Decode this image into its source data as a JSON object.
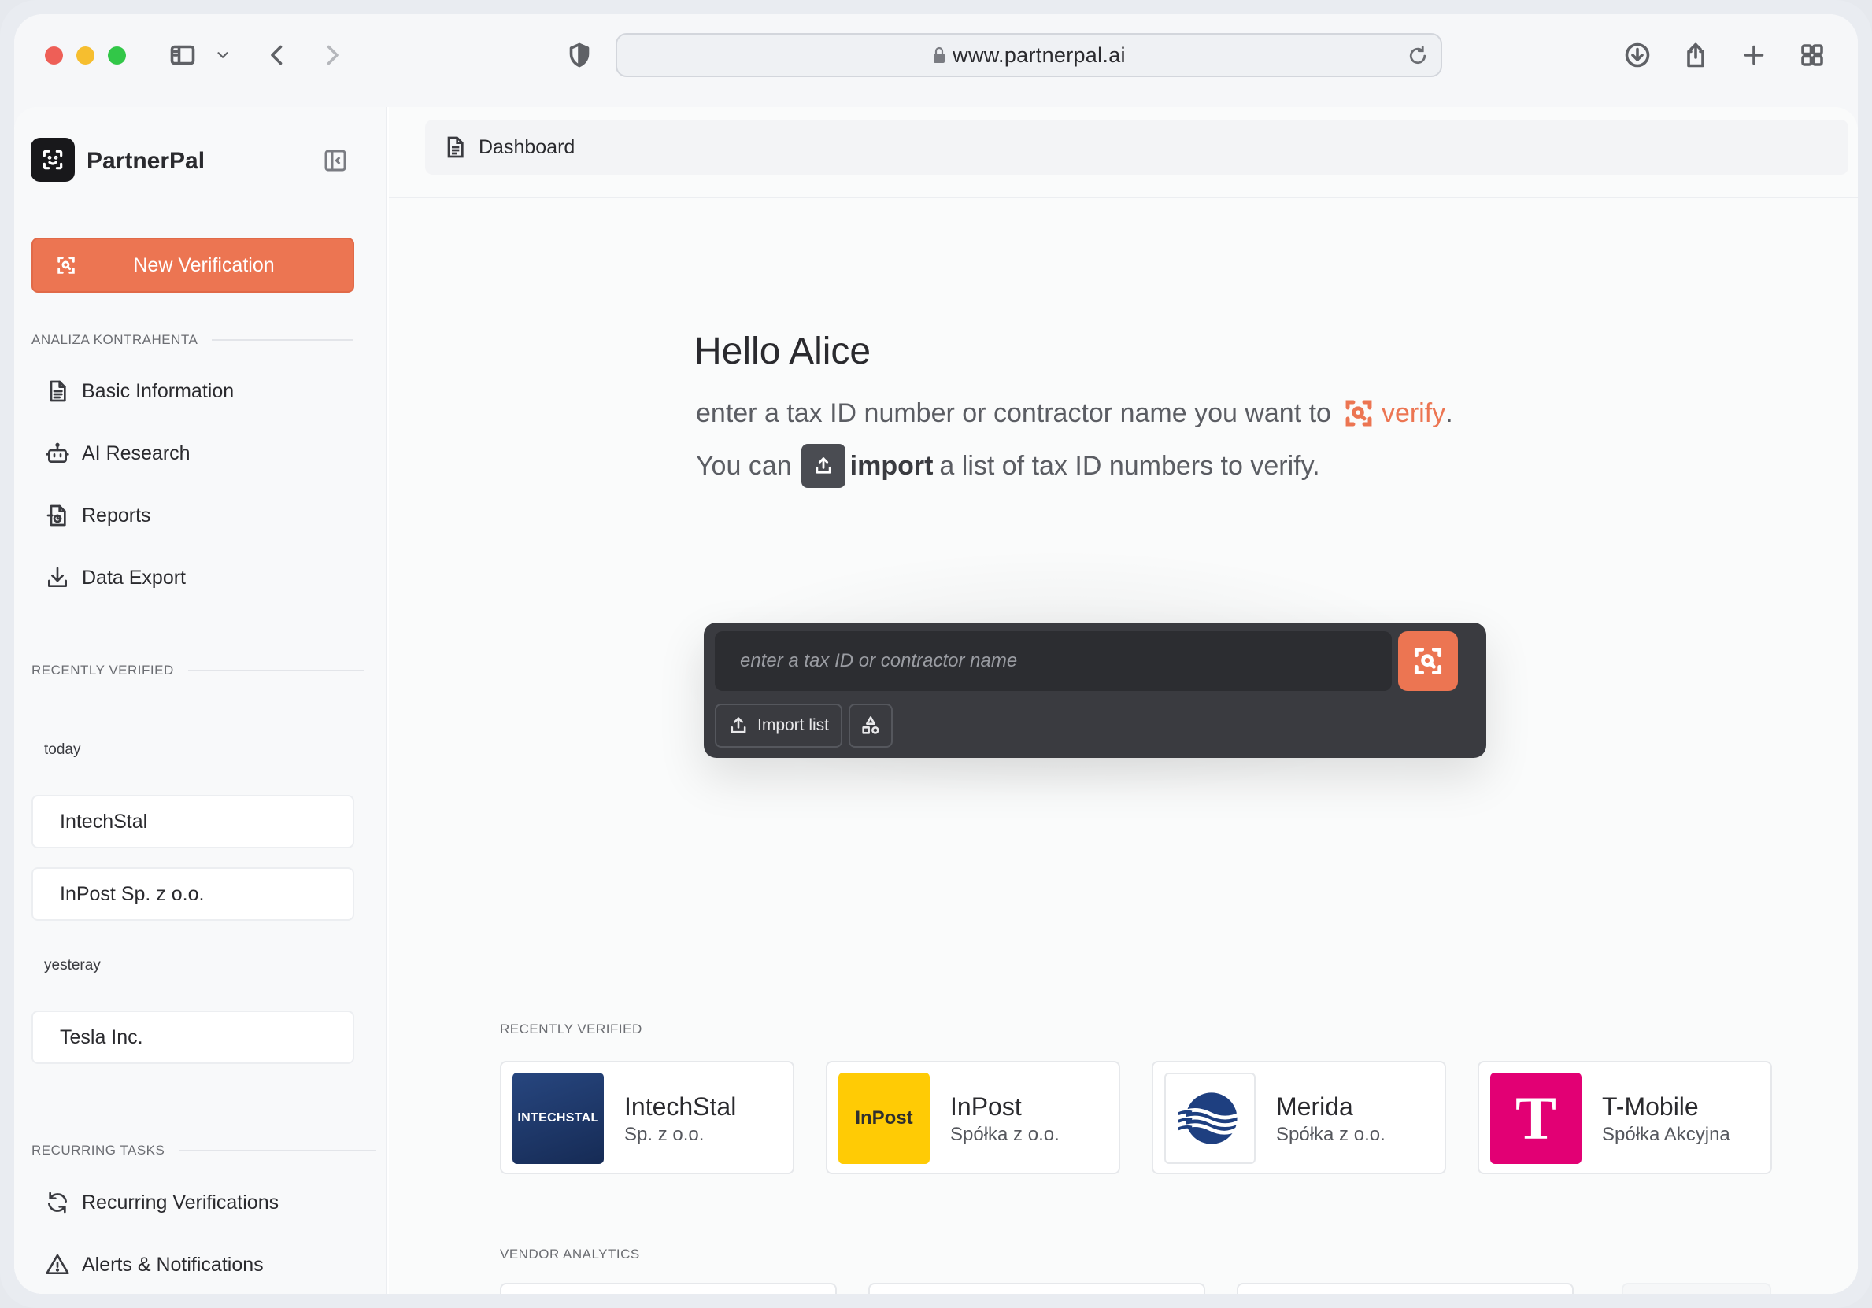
{
  "browser": {
    "url": "www.partnerpal.ai",
    "traffic_colors": {
      "close": "#ee5f57",
      "minimize": "#f6be2f",
      "zoom": "#32c748"
    }
  },
  "sidebar": {
    "brand": "PartnerPal",
    "new_verification_label": "New Verification",
    "accent": "#ec7552",
    "section_analysis": "ANALIZA KONTRAHENTA",
    "nav_items": [
      {
        "label": "Basic Information",
        "icon": "document-icon"
      },
      {
        "label": "AI Research",
        "icon": "robot-icon"
      },
      {
        "label": "Reports",
        "icon": "report-icon"
      },
      {
        "label": "Data Export",
        "icon": "download-icon"
      }
    ],
    "section_recent": "RECENTLY VERIFIED",
    "day_today": "today",
    "recent_today": [
      "IntechStal",
      "InPost Sp. z o.o."
    ],
    "day_yesterday": "yesteray",
    "recent_yesterday": [
      "Tesla Inc."
    ],
    "section_recurring": "RECURRING TASKS",
    "recurring_items": [
      {
        "label": "Recurring Verifications",
        "icon": "refresh-icon"
      },
      {
        "label": "Alerts & Notifications",
        "icon": "warning-icon"
      }
    ]
  },
  "main": {
    "breadcrumb": "Dashboard",
    "greeting": "Hello Alice",
    "prompt_line1_prefix": "enter a tax ID number or contractor name you want to",
    "prompt_verify": "verify",
    "prompt_line1_suffix": ".",
    "prompt_line2_prefix": "You can",
    "prompt_import": "import",
    "prompt_line2_suffix": "a list of tax ID numbers to verify.",
    "search_placeholder": "enter a tax ID or contractor name",
    "import_list_label": "Import list",
    "recent_section": "RECENTLY VERIFIED",
    "recent_companies": [
      {
        "name": "IntechStal",
        "type": "Sp. z o.o.",
        "logo_text": "INTECHSTAL",
        "logo_color": "#1f3a6e"
      },
      {
        "name": "InPost",
        "type": "Spółka z o.o.",
        "logo_text": "InPost",
        "logo_color": "#ffcb05"
      },
      {
        "name": "Merida",
        "type": "Spółka z o.o.",
        "logo_text": "",
        "logo_color": "#1e3f80"
      },
      {
        "name": "T-Mobile",
        "type": "Spółka Akcyjna",
        "logo_text": "T",
        "logo_color": "#e20074"
      }
    ],
    "analytics_section": "VENDOR ANALYTICS",
    "analytics_colors": [
      "#a9efc9",
      "#fcc08a",
      "#fcc08a"
    ]
  }
}
